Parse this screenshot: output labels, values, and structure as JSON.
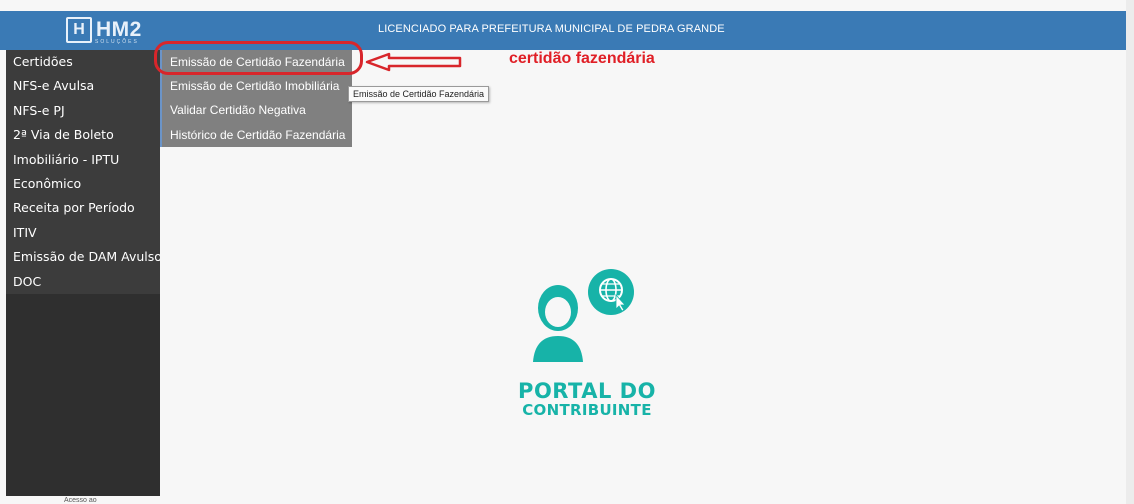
{
  "header": {
    "logo_text": "HM2",
    "logo_sub": "SOLUÇÕES",
    "license_text": "LICENCIADO PARA PREFEITURA MUNICIPAL DE PEDRA GRANDE"
  },
  "sidebar": {
    "items": [
      {
        "label": "Certidões"
      },
      {
        "label": "NFS-e Avulsa"
      },
      {
        "label": "NFS-e PJ"
      },
      {
        "label": "2ª Via de Boleto"
      },
      {
        "label": "Imobiliário - IPTU"
      },
      {
        "label": "Econômico"
      },
      {
        "label": "Receita por Período"
      },
      {
        "label": "ITIV"
      },
      {
        "label": "Emissão de DAM Avulso"
      },
      {
        "label": "DOC"
      }
    ]
  },
  "submenu": {
    "items": [
      {
        "label": "Emissão de Certidão Fazendária"
      },
      {
        "label": "Emissão de Certidão Imobiliária"
      },
      {
        "label": "Validar Certidão Negativa"
      },
      {
        "label": "Histórico de Certidão Fazendária"
      }
    ]
  },
  "tooltip": {
    "text": "Emissão de Certidão Fazendária"
  },
  "annotation": {
    "text": "certidão fazendária",
    "color": "#e01f26"
  },
  "portal": {
    "line1": "PORTAL DO",
    "line2": "CONTRIBUINTE",
    "color": "#17b3a8"
  },
  "footer": {
    "text": "Acesso ao"
  },
  "colors": {
    "header_bg": "#3a7ab5",
    "sidebar_bg": "#2f2f2f",
    "submenu_bg": "#808080",
    "accent": "#17b3a8",
    "annotation_red": "#d8262b"
  }
}
